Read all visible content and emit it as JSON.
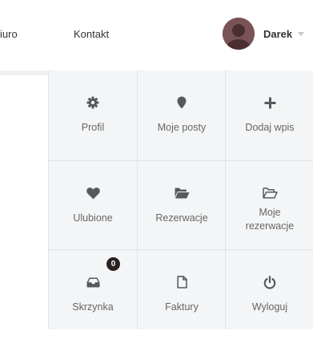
{
  "nav": {
    "biuro_partial": "iuro",
    "kontakt": "Kontakt"
  },
  "user": {
    "name": "Darek"
  },
  "menu": {
    "items": [
      {
        "label": "Profil",
        "icon": "gear-icon"
      },
      {
        "label": "Moje posty",
        "icon": "map-pin-icon"
      },
      {
        "label": "Dodaj wpis",
        "icon": "plus-icon"
      },
      {
        "label": "Ulubione",
        "icon": "heart-icon"
      },
      {
        "label": "Rezerwacje",
        "icon": "folder-open-filled-icon"
      },
      {
        "label": "Moje\nrezerwacje",
        "icon": "folder-open-outline-icon"
      },
      {
        "label": "Skrzynka",
        "icon": "inbox-icon",
        "badge": "0"
      },
      {
        "label": "Faktury",
        "icon": "file-icon"
      },
      {
        "label": "Wyloguj",
        "icon": "power-icon"
      }
    ]
  },
  "colors": {
    "icon": "#555a60",
    "panel_bg": "#f4f5f6",
    "grid_line": "#dfe1e3",
    "badge_bg": "#2b2020"
  }
}
